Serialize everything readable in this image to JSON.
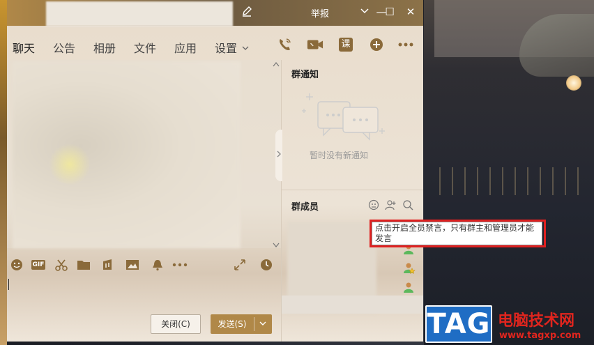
{
  "titlebar": {
    "report_label": "举报",
    "minimize_glyph": "—",
    "maximize_glyph": "☐",
    "close_glyph": "✕"
  },
  "tabs": [
    {
      "label": "聊天",
      "active": true
    },
    {
      "label": "公告"
    },
    {
      "label": "相册"
    },
    {
      "label": "文件"
    },
    {
      "label": "应用"
    },
    {
      "label": "设置"
    }
  ],
  "settings_dropdown_icon": "chevron-down-icon",
  "toolbar_icons": [
    "phone-icon",
    "video-icon",
    "class-icon",
    "add-app-icon",
    "more-icon"
  ],
  "class_glyph": "课",
  "chat_tools": [
    "emoji-icon",
    "gif-icon",
    "scissors-icon",
    "folder-icon",
    "music-icon",
    "image-icon",
    "bell-icon",
    "more-icon",
    "expand-icon",
    "history-icon"
  ],
  "gif_label": "GIF",
  "buttons": {
    "close_label": "关闭(C)",
    "send_label": "发送(S)"
  },
  "notice": {
    "title": "群通知",
    "empty_text": "暂时没有新通知"
  },
  "members": {
    "title": "群成员",
    "tooltip": "点击开启全员禁言，只有群主和管理员才能发言"
  },
  "watermark": {
    "tag": "TAG",
    "cn": "电脑技术网",
    "url": "www.tagxp.com"
  },
  "colors": {
    "accent": "#b08848",
    "highlight_frame": "#e02020",
    "watermark_blue": "#1f6dc4",
    "watermark_red": "#e0251e"
  }
}
